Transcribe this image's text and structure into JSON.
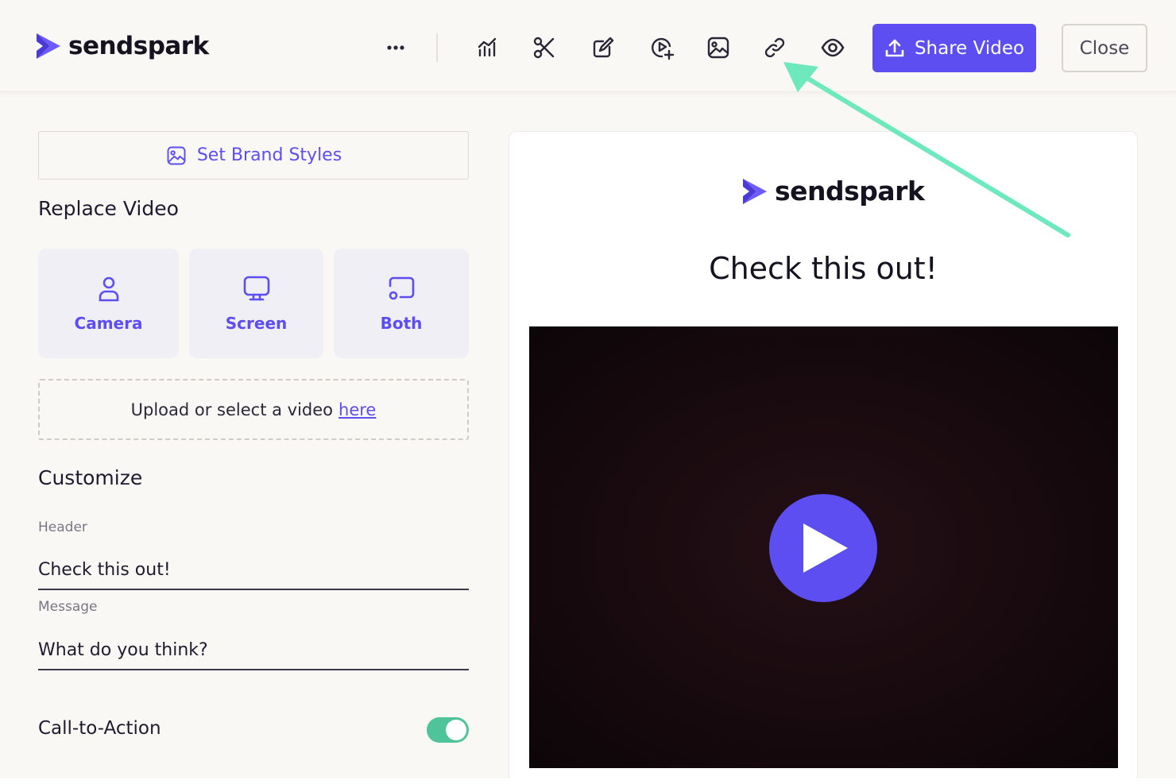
{
  "app": {
    "logo_text": "sendspark"
  },
  "topbar": {
    "tools": [
      {
        "icon": "more-icon"
      },
      {
        "icon": "analytics-icon"
      },
      {
        "icon": "scissors-icon"
      },
      {
        "icon": "edit-icon"
      },
      {
        "icon": "video-add-icon"
      },
      {
        "icon": "image-icon"
      },
      {
        "icon": "link-icon"
      },
      {
        "icon": "eye-icon"
      }
    ],
    "share_label": "Share Video",
    "close_label": "Close"
  },
  "left": {
    "brand_button_label": "Set Brand Styles",
    "replace_title": "Replace Video",
    "record_options": [
      {
        "label": "Camera",
        "icon": "person-icon"
      },
      {
        "label": "Screen",
        "icon": "monitor-icon"
      },
      {
        "label": "Both",
        "icon": "cast-icon"
      }
    ],
    "upload_text": "Upload or select a video",
    "upload_link": "here",
    "customize_title": "Customize",
    "header_label": "Header",
    "header_value": "Check this out!",
    "message_label": "Message",
    "message_value": "What do you think?",
    "cta_label": "Call-to-Action",
    "cta_enabled": true
  },
  "preview": {
    "logo_text": "sendspark",
    "title": "Check this out!"
  },
  "colors": {
    "accent": "#5c4ef0",
    "toggle_on": "#4fc49a",
    "annotation_arrow": "#6ee8bd"
  }
}
